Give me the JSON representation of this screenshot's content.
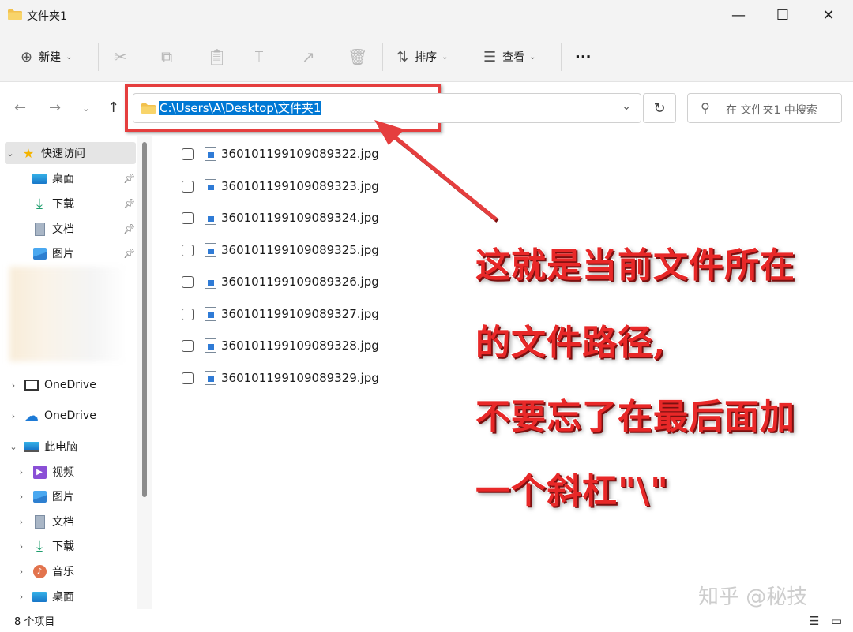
{
  "window": {
    "title": "文件夹1",
    "minimize": "—",
    "maximize": "☐",
    "close": "✕"
  },
  "toolbar": {
    "new_label": "新建",
    "sort_label": "排序",
    "view_label": "查看",
    "more_label": "···"
  },
  "address": {
    "path": "C:\\Users\\A\\Desktop\\文件夹1",
    "search_placeholder": "在 文件夹1 中搜索"
  },
  "sidebar": {
    "quick_access": "快速访问",
    "items": [
      {
        "label": "桌面"
      },
      {
        "label": "下载"
      },
      {
        "label": "文档"
      },
      {
        "label": "图片"
      }
    ],
    "onedrive_1": "OneDrive",
    "onedrive_2": "OneDrive",
    "this_pc": "此电脑",
    "pc_items": [
      {
        "label": "视频"
      },
      {
        "label": "图片"
      },
      {
        "label": "文档"
      },
      {
        "label": "下载"
      },
      {
        "label": "音乐"
      },
      {
        "label": "桌面"
      }
    ]
  },
  "files": [
    "360101199109089322.jpg",
    "360101199109089323.jpg",
    "360101199109089324.jpg",
    "360101199109089325.jpg",
    "360101199109089326.jpg",
    "360101199109089327.jpg",
    "360101199109089328.jpg",
    "360101199109089329.jpg"
  ],
  "annotation": {
    "line1": "这就是当前文件所在",
    "line2": "的文件路径,",
    "line3": "不要忘了在最后面加",
    "line4": "一个斜杠\"\\\""
  },
  "status": {
    "count": "8 个项目"
  },
  "watermark": "知乎 @秘技",
  "colors": {
    "accent": "#0078d4",
    "annotation_red": "#e53e3e",
    "folder": "#f2c14e"
  }
}
